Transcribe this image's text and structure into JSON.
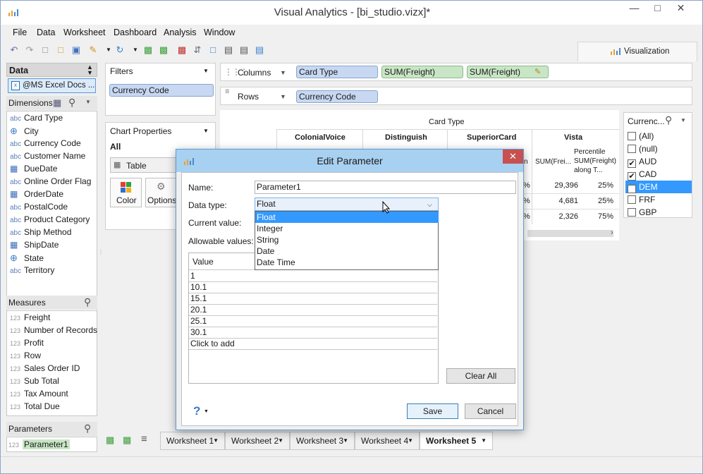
{
  "window": {
    "title": "Visual Analytics - [bi_studio.vizx]*"
  },
  "menu": [
    "File",
    "Data",
    "Worksheet",
    "Dashboard",
    "Analysis",
    "Window"
  ],
  "visualization_tab": "Visualization",
  "data_panel": {
    "header": "Data",
    "source": "@MS Excel Docs ...",
    "dimensions_header": "Dimensions",
    "dimensions": [
      {
        "type": "abc",
        "name": "Card Type"
      },
      {
        "type": "geo",
        "name": "City"
      },
      {
        "type": "abc",
        "name": "Currency Code"
      },
      {
        "type": "abc",
        "name": "Customer Name"
      },
      {
        "type": "date",
        "name": "DueDate"
      },
      {
        "type": "abc",
        "name": "Online Order Flag"
      },
      {
        "type": "date",
        "name": "OrderDate"
      },
      {
        "type": "abc",
        "name": "PostalCode"
      },
      {
        "type": "abc",
        "name": "Product Category"
      },
      {
        "type": "abc",
        "name": "Ship Method"
      },
      {
        "type": "date",
        "name": "ShipDate"
      },
      {
        "type": "geo",
        "name": "State"
      },
      {
        "type": "abc",
        "name": "Territory"
      }
    ],
    "measures_header": "Measures",
    "measures": [
      {
        "type": "123",
        "name": "Freight"
      },
      {
        "type": "123",
        "name": "Number of Records"
      },
      {
        "type": "123",
        "name": "Profit"
      },
      {
        "type": "123",
        "name": "Row"
      },
      {
        "type": "123",
        "name": "Sales Order ID"
      },
      {
        "type": "123",
        "name": "Sub Total"
      },
      {
        "type": "123",
        "name": "Tax Amount"
      },
      {
        "type": "123",
        "name": "Total Due"
      }
    ],
    "parameters_header": "Parameters",
    "parameters": [
      {
        "type": "123",
        "name": "Parameter1"
      }
    ]
  },
  "filters": {
    "header": "Filters",
    "items": [
      "Currency Code"
    ]
  },
  "chart_properties": {
    "header": "Chart Properties",
    "all_label": "All",
    "type": "Table",
    "color_label": "Color",
    "options_label": "Options"
  },
  "shelves": {
    "columns_label": "Columns",
    "columns": [
      "Card Type",
      "SUM(Freight)",
      "SUM(Freight)"
    ],
    "rows_label": "Rows",
    "rows": [
      "Currency Code"
    ]
  },
  "table_view": {
    "group_header": "Card Type",
    "col_headers": [
      "ColonialVoice",
      "Distinguish",
      "SuperiorCard",
      "Vista"
    ],
    "partial_header": "n",
    "vista_sub": [
      "SUM(Frei...",
      "Percentile SUM(Freight) along T..."
    ],
    "rows": [
      {
        "edge": "%",
        "sum": "29,396",
        "pct": "25%"
      },
      {
        "edge": "%",
        "sum": "4,681",
        "pct": "25%"
      },
      {
        "edge": "%",
        "sum": "2,326",
        "pct": "75%"
      }
    ]
  },
  "currency_filter": {
    "title": "Currenc...",
    "items": [
      {
        "label": "(All)",
        "checked": false,
        "selected": false
      },
      {
        "label": "(null)",
        "checked": false,
        "selected": false
      },
      {
        "label": "AUD",
        "checked": true,
        "selected": false
      },
      {
        "label": "CAD",
        "checked": true,
        "selected": false
      },
      {
        "label": "DEM",
        "checked": true,
        "selected": true
      },
      {
        "label": "FRF",
        "checked": false,
        "selected": false
      },
      {
        "label": "GBP",
        "checked": false,
        "selected": false
      }
    ]
  },
  "sheet_tabs": [
    "Worksheet 1",
    "Worksheet 2",
    "Worksheet 3",
    "Worksheet 4",
    "Worksheet 5"
  ],
  "active_sheet": "Worksheet 5",
  "dialog": {
    "title": "Edit Parameter",
    "name_label": "Name:",
    "name_value": "Parameter1",
    "datatype_label": "Data type:",
    "datatype_value": "Float",
    "datatype_options": [
      "Float",
      "Integer",
      "String",
      "Date",
      "Date Time"
    ],
    "current_label": "Current value:",
    "allowable_label": "Allowable values:",
    "values_header": "Value",
    "values": [
      "1",
      "10.1",
      "15.1",
      "20.1",
      "25.1",
      "30.1"
    ],
    "click_to_add": "Click to add",
    "clear_all": "Clear All",
    "save": "Save",
    "cancel": "Cancel",
    "help": "?"
  },
  "colors": {
    "accent": "#3399ff",
    "selection": "#3399ff",
    "pill": "#c8d8f2",
    "pill_green": "#c8e6c6"
  }
}
